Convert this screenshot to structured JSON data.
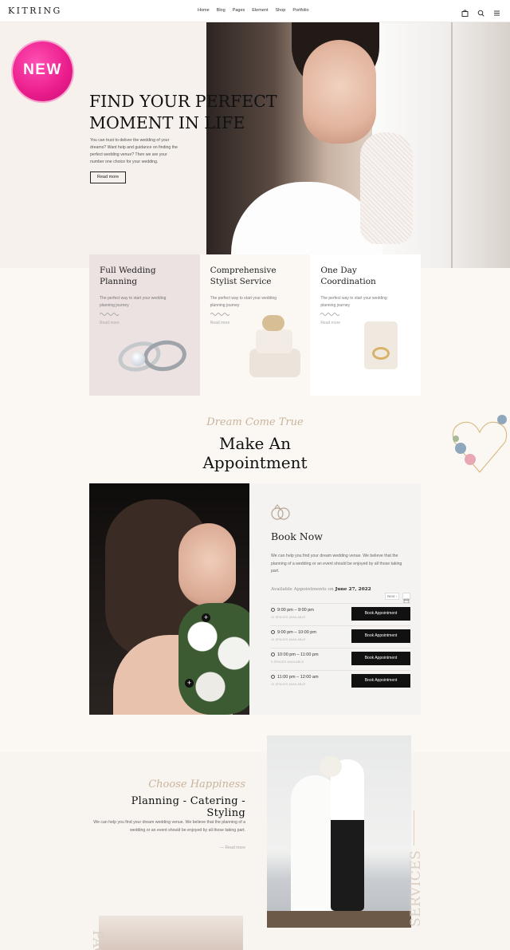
{
  "header": {
    "logo": "KITRING",
    "nav": [
      "Home",
      "Blog",
      "Pages",
      "Element",
      "Shop",
      "Portfolio"
    ],
    "icons": [
      "bag-icon",
      "search-icon",
      "menu-icon"
    ]
  },
  "hero": {
    "badge": "NEW",
    "title_line1": "FIND YOUR PERFECT",
    "title_line2": "MOMENT IN LIFE",
    "text": "You can trust to deliver the wedding of your dreams? Want help and guidance on finding the perfect wedding venue? Then we are your number one choice for your wedding.",
    "button": "Read more"
  },
  "services": [
    {
      "title": "Full Wedding Planning",
      "text": "The perfect way to start your wedding planning journey",
      "more": "Read more",
      "image": "wedding-rings"
    },
    {
      "title": "Comprehensive Stylist Service",
      "text": "The perfect way to start your wedding planning journey",
      "more": "Read more",
      "image": "wedding-cake"
    },
    {
      "title": "One Day Coordination",
      "text": "The perfect way to start your wedding planning journey",
      "more": "Read more",
      "image": "ring-box"
    }
  ],
  "appointment": {
    "script": "Dream Come True",
    "title_line1": "Make An",
    "title_line2": "Appointment",
    "book_title": "Book Now",
    "book_text": "We can help you find your dream wedding venue. We believe that the planning of a wedding or an event should be enjoyed by all those taking part.",
    "available_label": "Available Appointments on",
    "available_date": "June 27, 2022",
    "next_label": "Next",
    "slots": [
      {
        "time": "9:00 pm – 9:00 pm",
        "spaces": "10 SPACES AVAILABLE",
        "button": "Book Appointment"
      },
      {
        "time": "9:00 pm – 10:00 pm",
        "spaces": "10 SPACES AVAILABLE",
        "button": "Book Appointment"
      },
      {
        "time": "10:00 pm – 11:00 pm",
        "spaces": "9 SPACES AVAILABLE",
        "button": "Book Appointment"
      },
      {
        "time": "11:00 pm – 12:00 am",
        "spaces": "10 SPACES AVAILABLE",
        "button": "Book Appointment"
      }
    ]
  },
  "planning": {
    "script": "Choose Happiness",
    "title": "Planning - Catering - Styling",
    "text": "We can help you find your dream wedding venue. We believe that the planning of a wedding or an event should be enjoyed by all those taking part.",
    "more": "Read more",
    "side_label": "SERVICES",
    "side_label_2": "PAC"
  },
  "colors": {
    "accent_gold": "#c9b49b",
    "badge_pink": "#ea1c8c",
    "card_pink": "#ede2e2",
    "button_black": "#111111"
  }
}
